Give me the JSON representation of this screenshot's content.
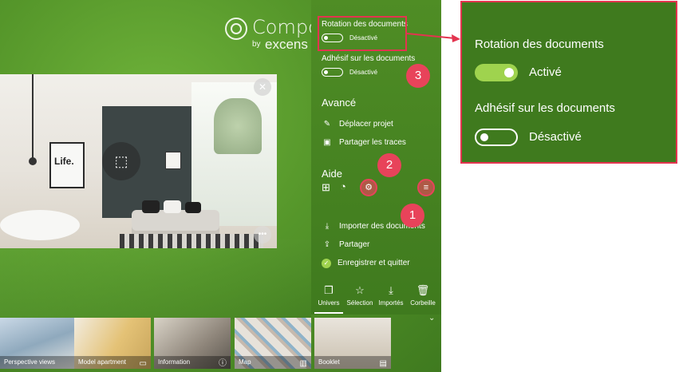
{
  "brand": {
    "name": "Compos",
    "by": "by",
    "company": "excens"
  },
  "panel": {
    "rotation": {
      "label": "Rotation des documents",
      "state": "Désactivé"
    },
    "adhesif": {
      "label": "Adhésif sur les documents",
      "state": "Désactivé"
    },
    "advanced_title": "Avancé",
    "move_project": "Déplacer projet",
    "share_traces": "Partager les traces",
    "help_title": "Aide",
    "import_docs": "Importer des documents",
    "share": "Partager",
    "save_quit": "Enregistrer et quitter",
    "tabs": [
      {
        "label": "Univers",
        "icon": "layers-icon"
      },
      {
        "label": "Sélection",
        "icon": "star-list-icon"
      },
      {
        "label": "Importés",
        "icon": "download-icon"
      },
      {
        "label": "Corbeille",
        "icon": "trash-icon"
      }
    ]
  },
  "thumbnails": [
    {
      "label": "Perspective views",
      "icon": ""
    },
    {
      "label": "Model apartment",
      "icon": "panorama-icon"
    },
    {
      "label": "Information",
      "icon": "info-icon"
    },
    {
      "label": "Map",
      "icon": "map-icon"
    },
    {
      "label": "Booklet",
      "icon": "booklet-icon"
    }
  ],
  "photo": {
    "frame_text": "Life."
  },
  "annotations": [
    "1",
    "2",
    "3"
  ],
  "zoom": {
    "rotation_label": "Rotation des documents",
    "rotation_state": "Activé",
    "adhesif_label": "Adhésif sur les documents",
    "adhesif_state": "Désactivé"
  },
  "colors": {
    "accent": "#e3344f",
    "panel_green": "#4f8d25",
    "toggle_on": "#9fd34e"
  }
}
